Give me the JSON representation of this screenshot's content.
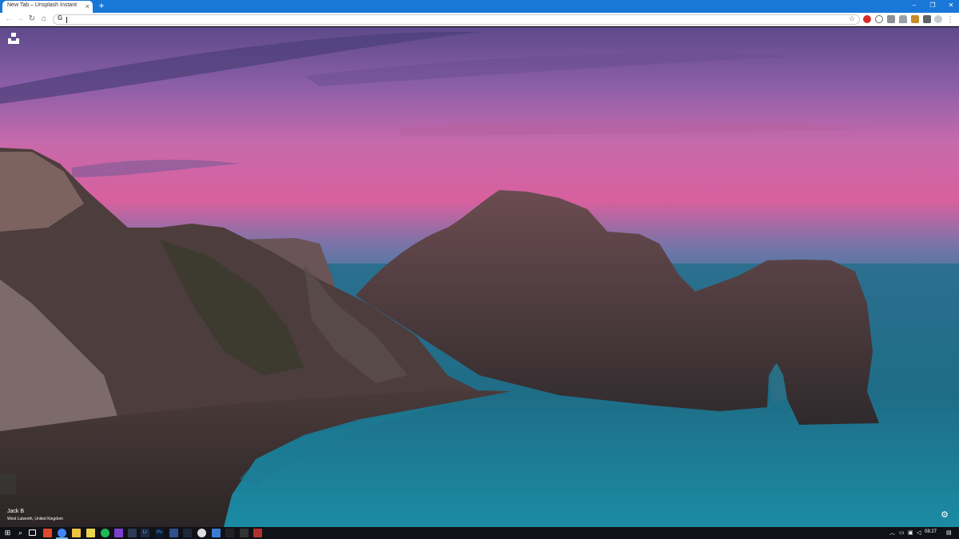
{
  "browser": {
    "tab_title": "New Tab – Unsplash Instant",
    "tab_close": "×",
    "new_tab": "+",
    "window_controls": {
      "minimize": "–",
      "maximize": "❐",
      "close": "✕"
    },
    "nav": {
      "back": "←",
      "forward": "→",
      "reload": "↻",
      "home": "⌂"
    },
    "omnibox_prefix": "G",
    "bookmark_star": "☆"
  },
  "unsplash": {
    "photographer": "Jack B",
    "location": "West Lulworth, United Kingdom",
    "settings_glyph": "⚙"
  },
  "taskbar": {
    "start_glyph": "⊞",
    "search_glyph": "⌕",
    "clock": "08:27",
    "tray_chevron": "︿"
  },
  "colors": {
    "titlebar": "#1977d8",
    "taskbar": "#101218",
    "sky_top": "#5e4a8a",
    "sky_pink": "#d8609e",
    "sea": "#1b6f87"
  }
}
